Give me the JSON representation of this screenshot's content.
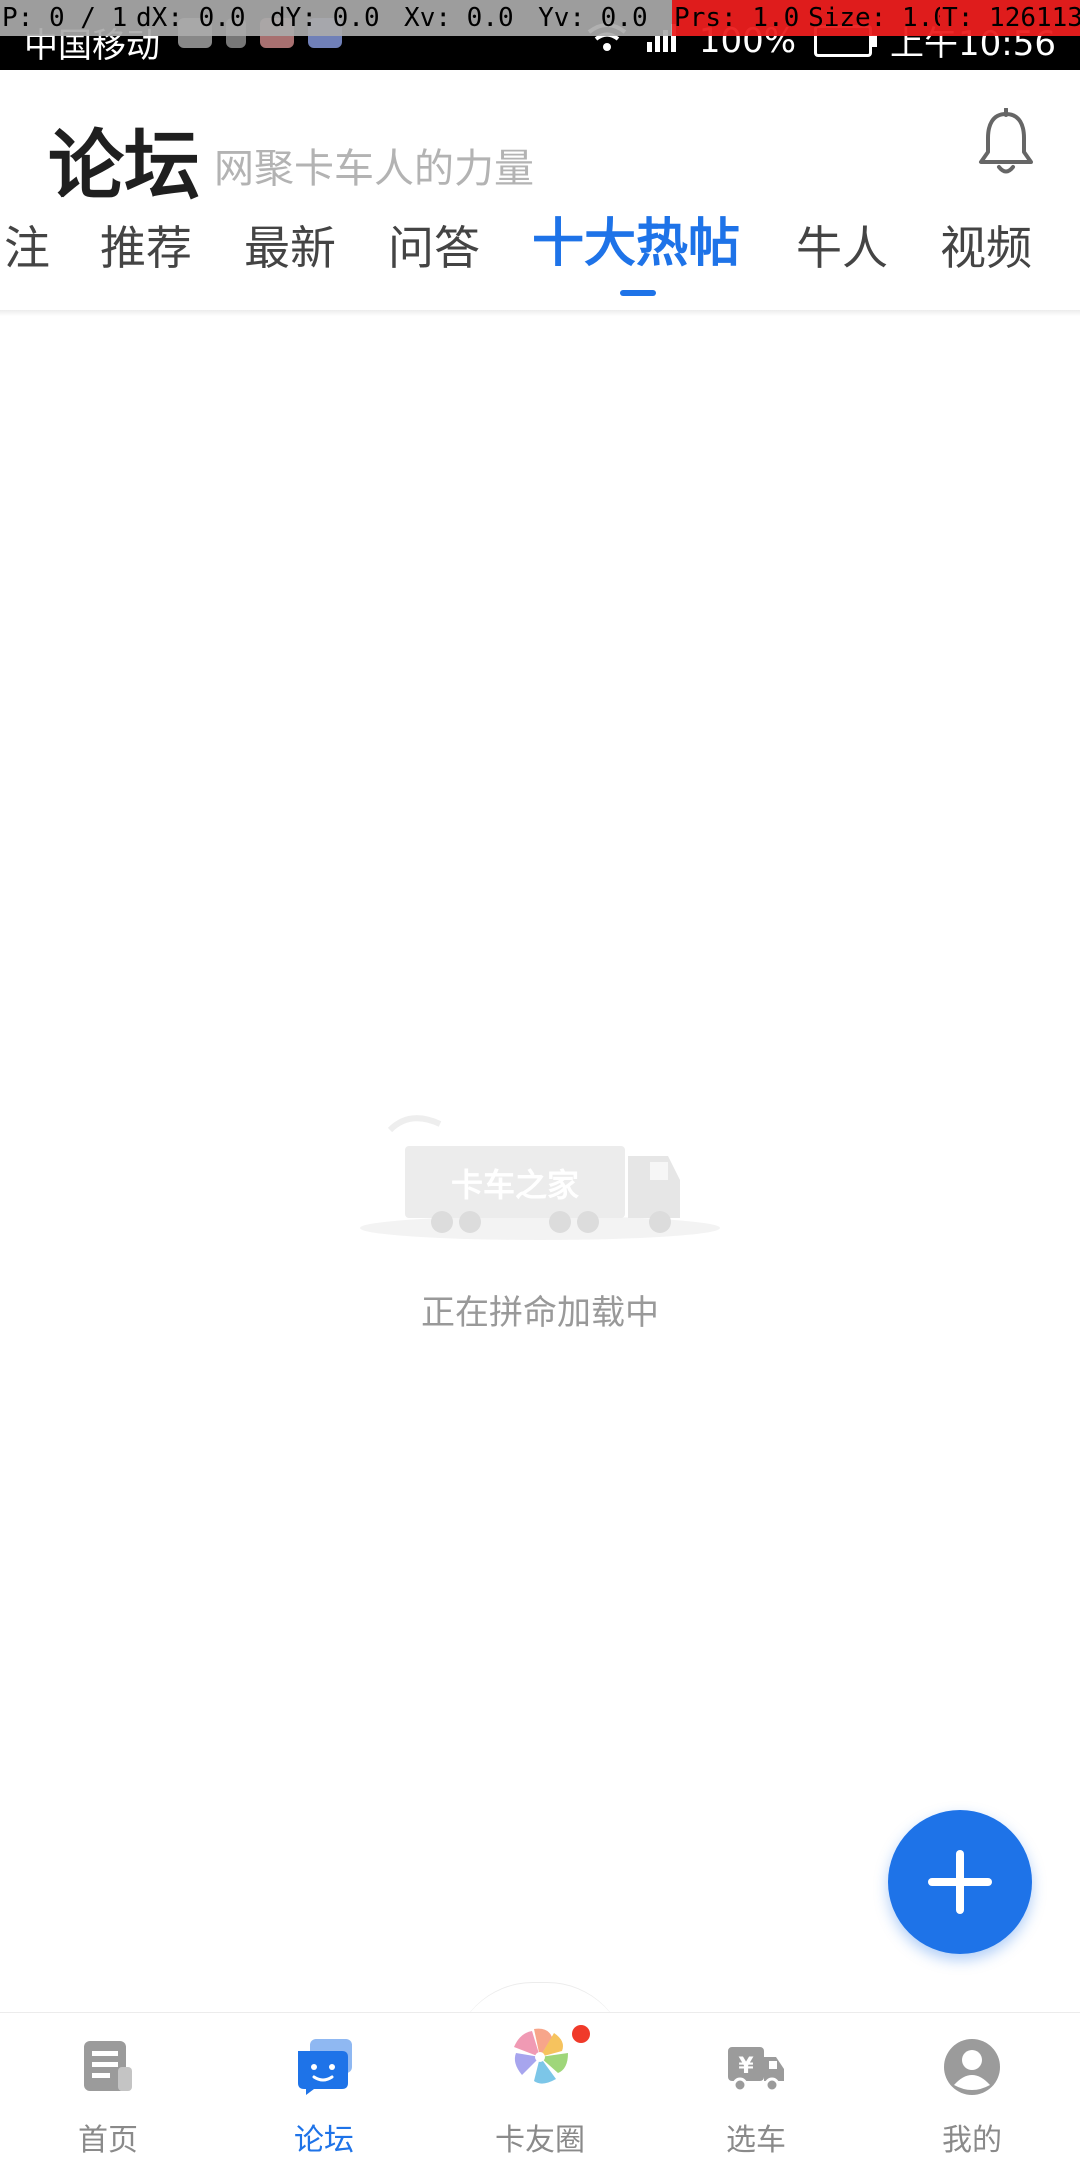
{
  "status_bar": {
    "carrier": "中国移动",
    "battery": "100%",
    "time": "上午10:56"
  },
  "debug_overlay": {
    "pointer": "P: 0 / 1",
    "dx": "dX: 0.0",
    "dy": "dY: 0.0",
    "xv": "Xv: 0.0",
    "yv": "Yv: 0.0",
    "prs": "Prs: 1.0",
    "size": "Size: 1.0",
    "t": "T: 126113"
  },
  "header": {
    "title": "论坛",
    "subtitle": "网聚卡车人的力量",
    "bell_icon": "bell-icon"
  },
  "tabs": [
    {
      "label": "注",
      "active": false
    },
    {
      "label": "推荐",
      "active": false
    },
    {
      "label": "最新",
      "active": false
    },
    {
      "label": "问答",
      "active": false
    },
    {
      "label": "十大热帖",
      "active": true
    },
    {
      "label": "牛人",
      "active": false
    },
    {
      "label": "视频",
      "active": false
    }
  ],
  "loading": {
    "watermark": "卡车之家",
    "text": "正在拼命加载中"
  },
  "fab": {
    "icon": "plus-icon"
  },
  "bottom_nav": [
    {
      "label": "首页",
      "icon": "news-icon",
      "active": false
    },
    {
      "label": "论坛",
      "icon": "chat-bubble-icon",
      "active": true
    },
    {
      "label": "卡友圈",
      "icon": "pinwheel-icon",
      "active": false
    },
    {
      "label": "选车",
      "icon": "truck-yen-icon",
      "active": false
    },
    {
      "label": "我的",
      "icon": "user-icon",
      "active": false
    }
  ],
  "colors": {
    "accent": "#1e73e8",
    "text_primary": "#1f1f1f",
    "text_muted": "#8a8a8a",
    "badge": "#f03a2a"
  }
}
